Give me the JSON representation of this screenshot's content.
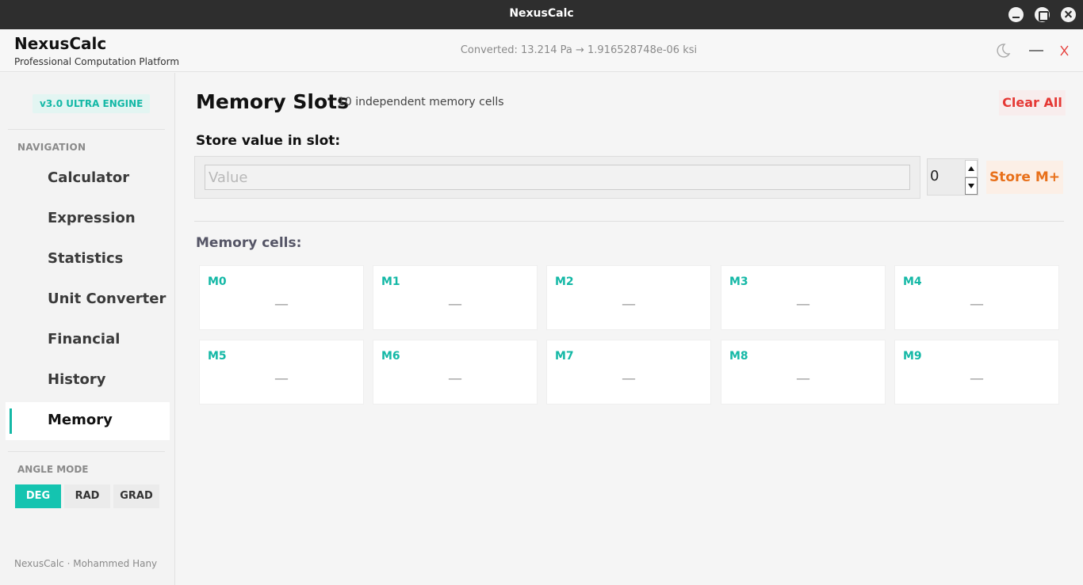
{
  "window": {
    "title": "NexusCalc"
  },
  "header": {
    "app_name": "NexusCalc",
    "tagline": "Professional Computation Platform",
    "status": "Converted: 13.214 Pa → 1.916528748e-06 ksi"
  },
  "sidebar": {
    "version_badge": "v3.0  ULTRA ENGINE",
    "nav_heading": "NAVIGATION",
    "items": [
      {
        "label": "Calculator"
      },
      {
        "label": "Expression"
      },
      {
        "label": "Statistics"
      },
      {
        "label": "Unit Converter"
      },
      {
        "label": "Financial"
      },
      {
        "label": "History"
      },
      {
        "label": "Memory"
      }
    ],
    "active_item": "Memory",
    "angle_heading": "ANGLE MODE",
    "angle_modes": [
      "DEG",
      "RAD",
      "GRAD"
    ],
    "angle_selected": "DEG",
    "footer": "NexusCalc · Mohammed Hany"
  },
  "main": {
    "title": "Memory Slots",
    "subtitle": "10 independent memory cells",
    "clear_label": "Clear All",
    "store_label": "Store value in slot:",
    "value_placeholder": "Value",
    "value": "",
    "slot_value": "0",
    "store_button": "Store M+",
    "cells_label": "Memory cells:",
    "cells": [
      {
        "name": "M0",
        "value": "—"
      },
      {
        "name": "M1",
        "value": "—"
      },
      {
        "name": "M2",
        "value": "—"
      },
      {
        "name": "M3",
        "value": "—"
      },
      {
        "name": "M4",
        "value": "—"
      },
      {
        "name": "M5",
        "value": "—"
      },
      {
        "name": "M6",
        "value": "—"
      },
      {
        "name": "M7",
        "value": "—"
      },
      {
        "name": "M8",
        "value": "—"
      },
      {
        "name": "M9",
        "value": "—"
      }
    ]
  },
  "colors": {
    "accent": "#14b8a6",
    "danger": "#e53935",
    "store": "#e8701a",
    "os_bar": "#2e2e2e"
  },
  "icons": {
    "theme": "moon-icon",
    "minimize": "minimize-icon",
    "close": "close-icon"
  }
}
